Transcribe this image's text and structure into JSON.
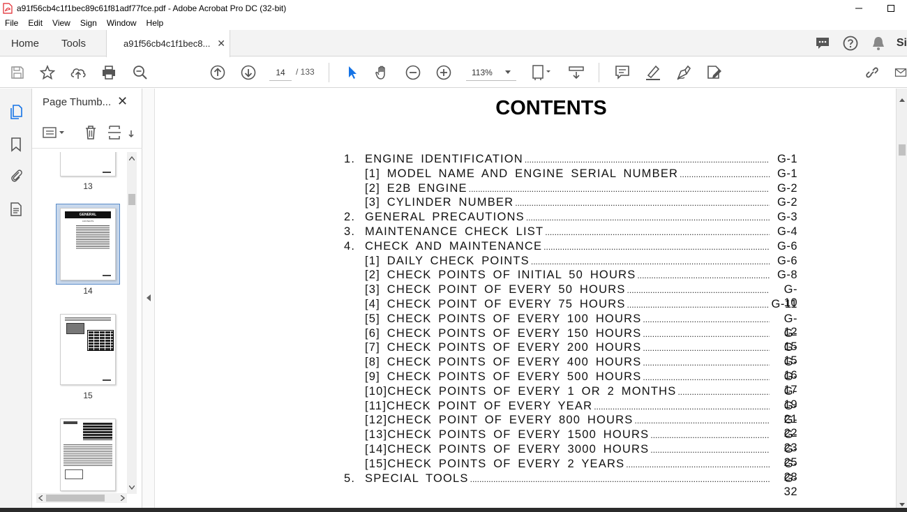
{
  "window": {
    "title": "a91f56cb4c1f1bec89c61f81adf77fce.pdf - Adobe Acrobat Pro DC (32-bit)"
  },
  "menu": [
    "File",
    "Edit",
    "View",
    "Sign",
    "Window",
    "Help"
  ],
  "tabs": {
    "home": "Home",
    "tools": "Tools",
    "document": "a91f56cb4c1f1bec8...",
    "sign_cut": "Si"
  },
  "toolbar": {
    "page_current": "14",
    "page_total": "/ 133",
    "zoom": "113%"
  },
  "thumb_panel": {
    "title": "Page Thumb...",
    "thumbnails": [
      {
        "label": "13"
      },
      {
        "label": "14",
        "selected": true,
        "header": "GENERAL",
        "subheader": "CONTENTS"
      },
      {
        "label": "15"
      },
      {
        "label": ""
      }
    ]
  },
  "document": {
    "title": "CONTENTS",
    "toc": [
      {
        "num": "1.",
        "text": "ENGINE IDENTIFICATION",
        "page": "G-1",
        "level": 0
      },
      {
        "num": "",
        "text": "[1] MODEL NAME AND ENGINE SERIAL NUMBER",
        "page": "G-1",
        "level": 1
      },
      {
        "num": "",
        "text": "[2] E2B ENGINE",
        "page": "G-2",
        "level": 1
      },
      {
        "num": "",
        "text": "[3] CYLINDER NUMBER",
        "page": "G-2",
        "level": 1
      },
      {
        "num": "2.",
        "text": "GENERAL PRECAUTIONS",
        "page": "G-3",
        "level": 0
      },
      {
        "num": "3.",
        "text": "MAINTENANCE CHECK LIST",
        "page": "G-4",
        "level": 0
      },
      {
        "num": "4.",
        "text": "CHECK AND MAINTENANCE",
        "page": "G-6",
        "level": 0
      },
      {
        "num": "",
        "text": "[1] DAILY CHECK POINTS",
        "page": "G-6",
        "level": 1
      },
      {
        "num": "",
        "text": "[2] CHECK POINTS OF INITIAL 50 HOURS",
        "page": "G-8",
        "level": 1
      },
      {
        "num": "",
        "text": "[3] CHECK POINT OF EVERY 50 HOURS",
        "page": "G-10",
        "level": 1
      },
      {
        "num": "",
        "text": "[4] CHECK POINT OF EVERY 75 HOURS",
        "page": "G-11",
        "level": 1
      },
      {
        "num": "",
        "text": "[5] CHECK POINTS OF EVERY 100 HOURS",
        "page": "G-12",
        "level": 1
      },
      {
        "num": "",
        "text": "[6] CHECK POINTS OF EVERY 150 HOURS",
        "page": "G-15",
        "level": 1
      },
      {
        "num": "",
        "text": "[7] CHECK POINTS OF EVERY 200 HOURS",
        "page": "G-15",
        "level": 1
      },
      {
        "num": "",
        "text": "[8] CHECK POINTS OF EVERY 400 HOURS",
        "page": "G-16",
        "level": 1
      },
      {
        "num": "",
        "text": "[9] CHECK POINTS OF EVERY 500 HOURS",
        "page": "G-17",
        "level": 1
      },
      {
        "num": "",
        "text": "[10]CHECK POINTS OF EVERY 1 OR 2 MONTHS",
        "page": "G-19",
        "level": 1
      },
      {
        "num": "",
        "text": "[11]CHECK POINT OF EVERY YEAR",
        "page": "G-21",
        "level": 1
      },
      {
        "num": "",
        "text": "[12]CHECK POINT OF EVERY 800 HOURS",
        "page": "G-22",
        "level": 1
      },
      {
        "num": "",
        "text": "[13]CHECK POINTS OF EVERY 1500 HOURS",
        "page": "G-23",
        "level": 1
      },
      {
        "num": "",
        "text": "[14]CHECK POINTS OF EVERY 3000 HOURS",
        "page": "G-25",
        "level": 1
      },
      {
        "num": "",
        "text": "[15]CHECK POINTS OF EVERY 2 YEARS",
        "page": "G-28",
        "level": 1
      },
      {
        "num": "5.",
        "text": "SPECIAL TOOLS",
        "page": "G-32",
        "level": 0
      }
    ]
  },
  "colors": {
    "accent_blue": "#1473e6",
    "pdf_red": "#e0242a",
    "thumb_selected": "#c8d8ec"
  }
}
